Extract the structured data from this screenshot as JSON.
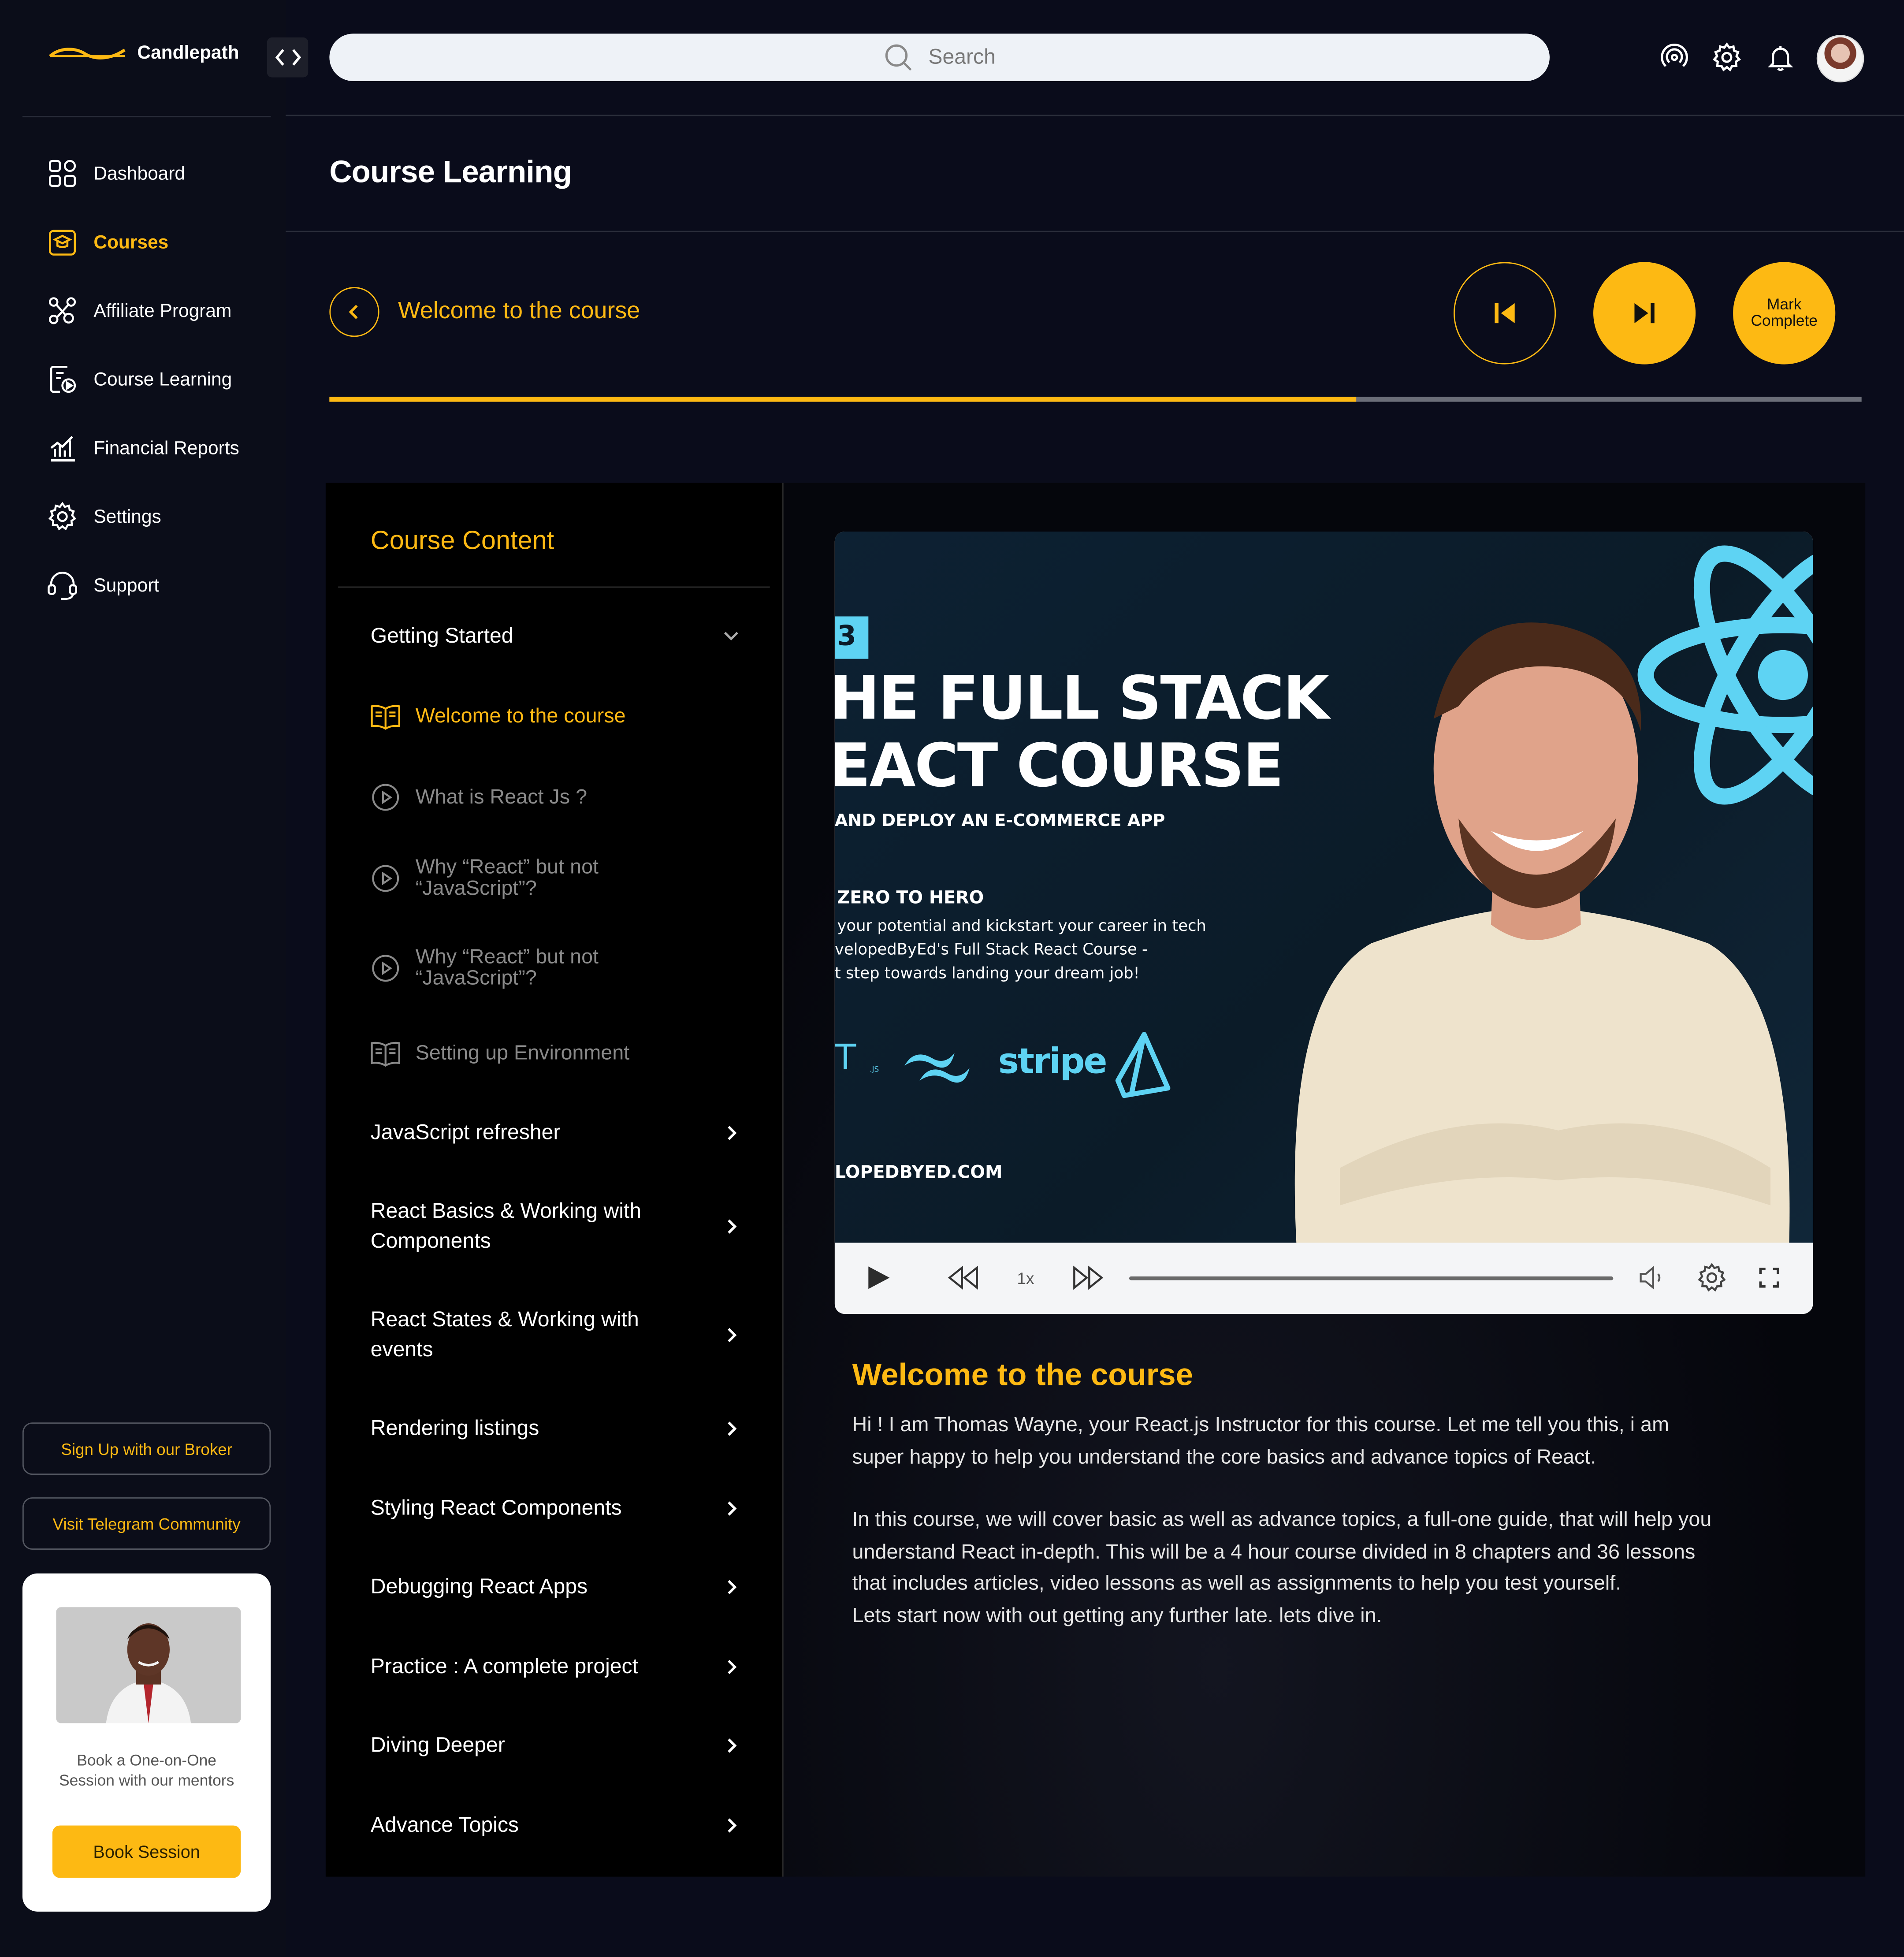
{
  "app": {
    "brand": "Candlepath",
    "search_placeholder": "Search",
    "page_title": "Course Learning"
  },
  "sidebar": {
    "items": [
      {
        "label": "Dashboard",
        "icon": "grid-icon"
      },
      {
        "label": "Courses",
        "icon": "graduation-cap-icon",
        "active": true
      },
      {
        "label": "Affiliate Program",
        "icon": "network-icon"
      },
      {
        "label": "Course Learning",
        "icon": "play-document-icon"
      },
      {
        "label": "Financial Reports",
        "icon": "chart-icon"
      },
      {
        "label": "Settings",
        "icon": "gear-icon"
      },
      {
        "label": "Support",
        "icon": "headset-icon"
      }
    ],
    "broker_button": "Sign Up with our Broker",
    "telegram_button": "Visit Telegram Community",
    "mentor_card": {
      "text": "Book a One-on-One Session with our mentors",
      "button": "Book Session"
    }
  },
  "lesson_header": {
    "title": "Welcome to the course",
    "mark_complete": "Mark Complete",
    "progress_fraction": 0.67
  },
  "course_content": {
    "title": "Course Content",
    "open_section": "Getting Started",
    "lessons": [
      {
        "label": "Welcome to the course",
        "type": "article",
        "current": true
      },
      {
        "label": "What is React Js ?",
        "type": "video"
      },
      {
        "label": "Why “React” but not “JavaScript”?",
        "type": "video"
      },
      {
        "label": "Why “React” but not “JavaScript”?",
        "type": "video"
      },
      {
        "label": "Setting up Environment",
        "type": "article"
      }
    ],
    "sections": [
      "JavaScript refresher",
      "React Basics & Working with Components",
      "React States & Working with events",
      "Rendering listings",
      "Styling React Components",
      "Debugging React Apps",
      "Practice : A complete project",
      "Diving Deeper",
      "Advance Topics"
    ]
  },
  "video": {
    "thumbnail": {
      "badge": "3",
      "line1": "HE FULL STACK",
      "line2": "EACT COURSE",
      "line3": "AND DEPLOY AN E-COMMERCE APP",
      "hero": "ZERO TO HERO",
      "desc1": "your potential and kickstart your career in tech",
      "desc2": "velopedByEd's Full Stack React Course -",
      "desc3": "t step towards landing your dream job!",
      "logo_partial": "T",
      "logo_partial_sub": ".JS",
      "stripe": "stripe",
      "site": "LOPEDBYED.COM"
    },
    "speed": "1x",
    "progress_fraction": 0
  },
  "lesson_body": {
    "title": "Welcome to the course",
    "paragraph1": "Hi ! I am Thomas Wayne, your React.js Instructor for this course. Let me tell  you this, i am\nsuper happy to help you understand the core basics and advance topics of React.",
    "paragraph2": "In this course, we will cover basic as well as advance topics, a full-one guide, that will help you\nunderstand React  in-depth. This will be a 4 hour course divided in 8 chapters and 36 lessons\nthat includes articles, video lessons as well as assignments to help you test yourself.\nLets start now with out getting any further late. lets dive in."
  },
  "colors": {
    "accent": "#fdb913",
    "background": "#0a0c1b",
    "panel": "#000000",
    "react_blue": "#5ed3f3"
  }
}
